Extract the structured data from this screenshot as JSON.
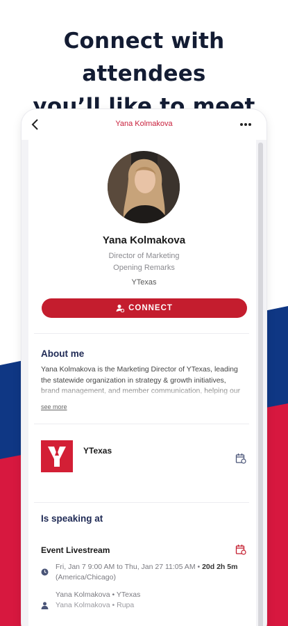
{
  "headline": {
    "line1": "Connect with attendees",
    "line2": "you’ll like to meet"
  },
  "topbar": {
    "title": "Yana Kolmakova"
  },
  "profile": {
    "name": "Yana Kolmakova",
    "title": "Director of Marketing",
    "session": "Opening Remarks",
    "organization": "YTexas",
    "connect_label": "CONNECT"
  },
  "about": {
    "heading": "About me",
    "text": "Yana Kolmakova is the Marketing Director of YTexas, leading the statewide organization in strategy & growth initiatives, brand management, and member communication, helping our community of Texans stay connected.",
    "see_more": "see more"
  },
  "organization": {
    "name": "YTexas"
  },
  "speaking": {
    "heading": "Is speaking at",
    "event_title": "Event Livestream",
    "time_prefix": "Fri, Jan 7 9:00 AM to Thu, Jan 27 11:05 AM • ",
    "duration": "20d 2h 5m",
    "timezone": " (America/Chicago)",
    "speaker_line": "Yana Kolmakova • YTexas",
    "speaker_line2": "Yana Kolmakova • Rupa"
  },
  "colors": {
    "brand_red": "#c41d2e",
    "navy": "#1f2a55",
    "bg_red": "#d7183f",
    "bg_blue": "#0f3784"
  },
  "icons": [
    "back-chevron-icon",
    "more-dots-icon",
    "connect-user-icon",
    "calendar-icon",
    "clock-icon",
    "person-icon"
  ]
}
